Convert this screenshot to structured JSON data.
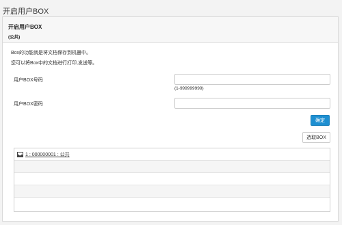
{
  "page": {
    "title": "开启用户BOX"
  },
  "panel": {
    "header_title": "开启用户BOX",
    "header_subtitle": "(公共)",
    "description_1": "Box的功能就是将文档保存到机器中。",
    "description_2": "您可以将Box中的文档进行打印,发送等。"
  },
  "form": {
    "box_number_label": "用户BOX号码",
    "box_number_value": "",
    "box_number_hint": "(1-999999999)",
    "box_password_label": "用户BOX密码",
    "box_password_value": "",
    "confirm_label": "确定",
    "select_box_label": "选取BOX"
  },
  "box_list": {
    "rows": [
      {
        "label": "1 : 000000001 : 公共",
        "icon": "inbox-icon"
      }
    ]
  },
  "colors": {
    "primary": "#1e8fd1"
  }
}
